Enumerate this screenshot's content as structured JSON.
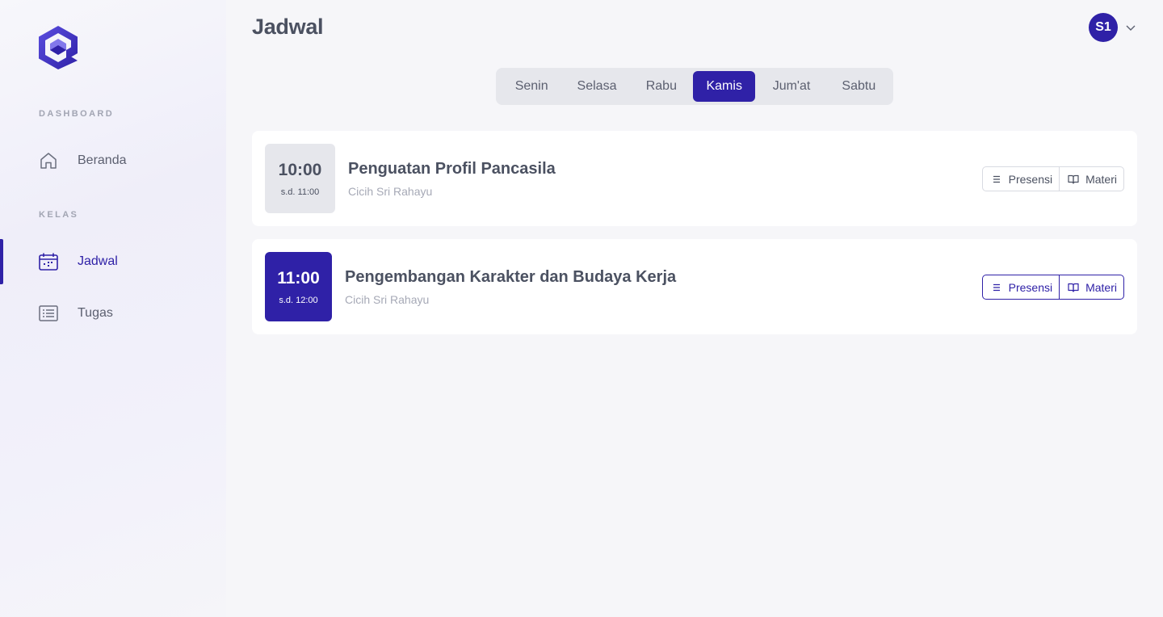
{
  "sidebar": {
    "sections": [
      {
        "label": "DASHBOARD"
      },
      {
        "label": "KELAS"
      }
    ],
    "items": [
      {
        "label": "Beranda",
        "icon": "home-icon"
      },
      {
        "label": "Jadwal",
        "icon": "calendar-icon",
        "active": true
      },
      {
        "label": "Tugas",
        "icon": "list-icon"
      }
    ]
  },
  "header": {
    "title": "Jadwal",
    "avatar_initials": "S1"
  },
  "days": [
    "Senin",
    "Selasa",
    "Rabu",
    "Kamis",
    "Jum'at",
    "Sabtu"
  ],
  "active_day": "Kamis",
  "schedule": [
    {
      "start": "10:00",
      "end": "s.d. 11:00",
      "subject": "Penguatan Profil Pancasila",
      "teacher": "Cicih Sri Rahayu",
      "presensi_label": "Presensi",
      "materi_label": "Materi",
      "current": false
    },
    {
      "start": "11:00",
      "end": "s.d. 12:00",
      "subject": "Pengembangan Karakter dan Budaya Kerja",
      "teacher": "Cicih Sri Rahayu",
      "presensi_label": "Presensi",
      "materi_label": "Materi",
      "current": true
    }
  ],
  "colors": {
    "accent": "#2f21a7",
    "text": "#4b5161",
    "muted": "#a6a9b6",
    "background": "#f6f6f9"
  }
}
